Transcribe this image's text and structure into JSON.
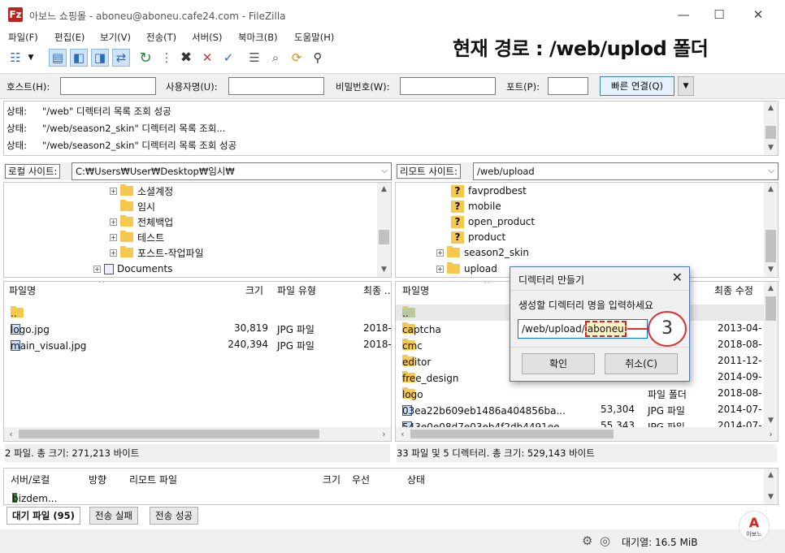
{
  "window": {
    "title": "아보느 쇼핑몰 - aboneu@aboneu.cafe24.com - FileZilla",
    "app_icon": "Fz",
    "controls": {
      "minimize": "—",
      "maximize": "☐",
      "close": "✕"
    }
  },
  "menu": [
    "파일(F)",
    "편집(E)",
    "보기(V)",
    "전송(T)",
    "서버(S)",
    "북마크(B)",
    "도움말(H)"
  ],
  "overlay_title": "현재 경로 : /web/uplod 폴더",
  "toolbar_icons": [
    "site-manager-icon",
    "dropdown-icon",
    "toggle-log-icon",
    "toggle-local-tree-icon",
    "toggle-remote-tree-icon",
    "toggle-queue-icon",
    "refresh-icon",
    "process-queue-icon",
    "cancel-icon",
    "disconnect-icon",
    "reconnect-icon",
    "filter-icon",
    "compare-icon",
    "sync-browse-icon",
    "search-icon"
  ],
  "quickconnect": {
    "host_label": "호스트(H):",
    "user_label": "사용자명(U):",
    "pass_label": "비밀번호(W):",
    "port_label": "포트(P):",
    "button": "빠른 연결(Q)",
    "host_value": "",
    "user_value": "",
    "pass_value": "",
    "port_value": ""
  },
  "log": [
    {
      "status": "상태:",
      "text": "\"/web\" 디렉터리 목록 조회 성공"
    },
    {
      "status": "상태:",
      "text": "\"/web/season2_skin\" 디렉터리 목록 조회..."
    },
    {
      "status": "상태:",
      "text": "\"/web/season2_skin\" 디렉터리 목록 조회 성공"
    }
  ],
  "local": {
    "site_label": "로컬 사이트:",
    "path": "C:₩Users₩User₩Desktop₩임시₩",
    "tree": [
      {
        "label": "소셜계정",
        "expander": "+"
      },
      {
        "label": "임시",
        "expander": ""
      },
      {
        "label": "전체백업",
        "expander": "+"
      },
      {
        "label": "테스트",
        "expander": "+"
      },
      {
        "label": "포스트-작업파일",
        "expander": "+"
      },
      {
        "label": "Documents",
        "expander": "+"
      }
    ],
    "columns": {
      "name": "파일명",
      "size": "크기",
      "type": "파일 유형",
      "modified": "최종 ..."
    },
    "files": [
      {
        "name": "..",
        "size": "",
        "type": "",
        "modified": ""
      },
      {
        "name": "logo.jpg",
        "size": "30,819",
        "type": "JPG 파일",
        "modified": "2018-"
      },
      {
        "name": "main_visual.jpg",
        "size": "240,394",
        "type": "JPG 파일",
        "modified": "2018-"
      }
    ],
    "status": "2 파일. 총 크기: 271,213 바이트"
  },
  "remote": {
    "site_label": "리모트 사이트:",
    "path": "/web/upload",
    "tree": [
      {
        "label": "favprodbest",
        "unknown": true
      },
      {
        "label": "mobile",
        "unknown": true
      },
      {
        "label": "open_product",
        "unknown": true
      },
      {
        "label": "product",
        "unknown": true
      },
      {
        "label": "season2_skin",
        "unknown": false,
        "expander": "+"
      },
      {
        "label": "upload",
        "unknown": false,
        "expander": "+"
      }
    ],
    "columns": {
      "name": "파일명",
      "size": "크기",
      "type": "파일 유형",
      "modified": "최종 수정"
    },
    "files": [
      {
        "name": "..",
        "size": "",
        "type": "",
        "modified": ""
      },
      {
        "name": "captcha",
        "size": "",
        "type": "",
        "modified": "2013-04-"
      },
      {
        "name": "cmc",
        "size": "",
        "type": "",
        "modified": "2018-08-"
      },
      {
        "name": "editor",
        "size": "",
        "type": "",
        "modified": "2011-12-"
      },
      {
        "name": "free_design",
        "size": "",
        "type": "",
        "modified": "2014-09-"
      },
      {
        "name": "logo",
        "size": "",
        "type": "파일 폴더",
        "modified": "2018-08-"
      },
      {
        "name": "03ea22b609eb1486a404856ba...",
        "size": "53,304",
        "type": "JPG 파일",
        "modified": "2014-07-"
      },
      {
        "name": "543e0e08d7e03eb4f2db4491ee...",
        "size": "55,343",
        "type": "JPG 파일",
        "modified": "2014-07-"
      }
    ],
    "status": "33 파일 및 5 디렉터리. 총 크기: 529,143 바이트"
  },
  "queue": {
    "columns": [
      "서버/로컬",
      "방향",
      "리모트 파일",
      "크기",
      "우선",
      "상태"
    ],
    "rows": [
      {
        "server": "bizdem..."
      }
    ],
    "tabs": [
      "대기 파일 (95)",
      "전송 실패",
      "전송 성공"
    ]
  },
  "statusbar": {
    "queue_text": "대기열: 16.5 MiB"
  },
  "dialog": {
    "title": "디렉터리 만들기",
    "prompt": "생성할 디렉터리 명을 입력하세요",
    "input_prefix": "/web/upload/",
    "input_highlight": "aboneu",
    "ok": "확인",
    "cancel": "취소(C)"
  },
  "callout": "3",
  "logo": {
    "letter": "A",
    "text": "아보느",
    "color": "#e02020"
  }
}
